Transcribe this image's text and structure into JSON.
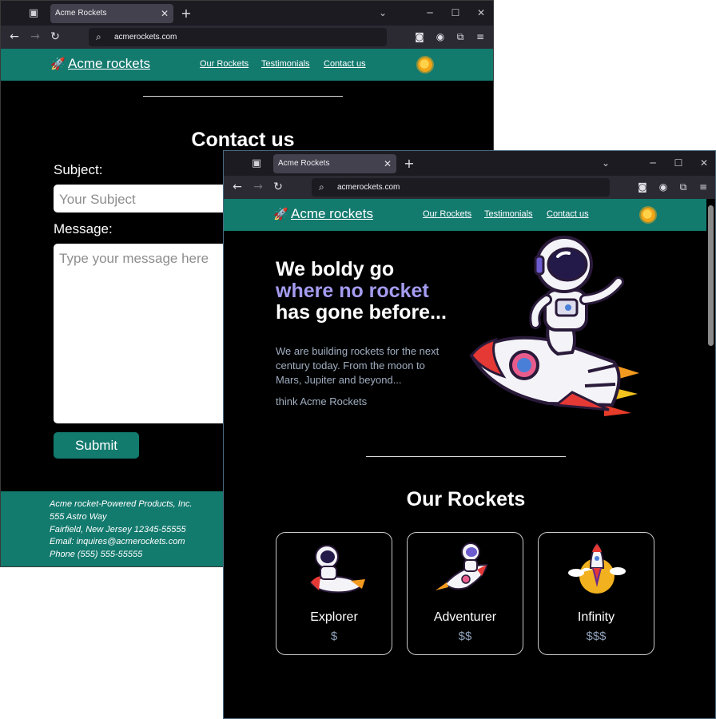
{
  "back_window": {
    "browser": {
      "tab_title": "Acme Rockets",
      "url": "acmerockets.com"
    },
    "site": {
      "logo": "Acme rockets",
      "nav": [
        "Our Rockets",
        "Testimonials",
        "Contact us"
      ]
    },
    "contact": {
      "title": "Contact us",
      "subject_label": "Subject:",
      "subject_placeholder": "Your Subject",
      "message_label": "Message:",
      "message_placeholder": "Type your message here",
      "submit_label": "Submit"
    },
    "footer": {
      "lines": [
        "Acme rocket-Powered Products, Inc.",
        "555 Astro Way",
        "Fairfield, New Jersey 12345-55555",
        "Email: inquires@acmerockets.com",
        "Phone (555) 555-55555"
      ]
    }
  },
  "front_window": {
    "browser": {
      "tab_title": "Acme Rockets",
      "url": "acmerockets.com"
    },
    "site": {
      "logo": "Acme rockets",
      "nav": [
        "Our Rockets",
        "Testimonials",
        "Contact us"
      ]
    },
    "hero": {
      "line1": "We boldy go",
      "line2": "where no rocket",
      "line3": "has gone before...",
      "description": [
        "We are building rockets for the next",
        "century today. From the moon to",
        "Mars, Jupiter and beyond..."
      ],
      "tagline": "think Acme Rockets"
    },
    "rockets_section": {
      "title": "Our Rockets",
      "cards": [
        {
          "name": "Explorer",
          "price": "$",
          "image_icon": "astronaut-riding-rocket-icon"
        },
        {
          "name": "Adventurer",
          "price": "$$",
          "image_icon": "astronaut-flying-rocket-icon"
        },
        {
          "name": "Infinity",
          "price": "$$$",
          "image_icon": "rocket-launch-icon"
        }
      ]
    }
  },
  "colors": {
    "brand_teal": "#137a6e",
    "hero_accent": "#a49cf0",
    "background": "#000000"
  }
}
